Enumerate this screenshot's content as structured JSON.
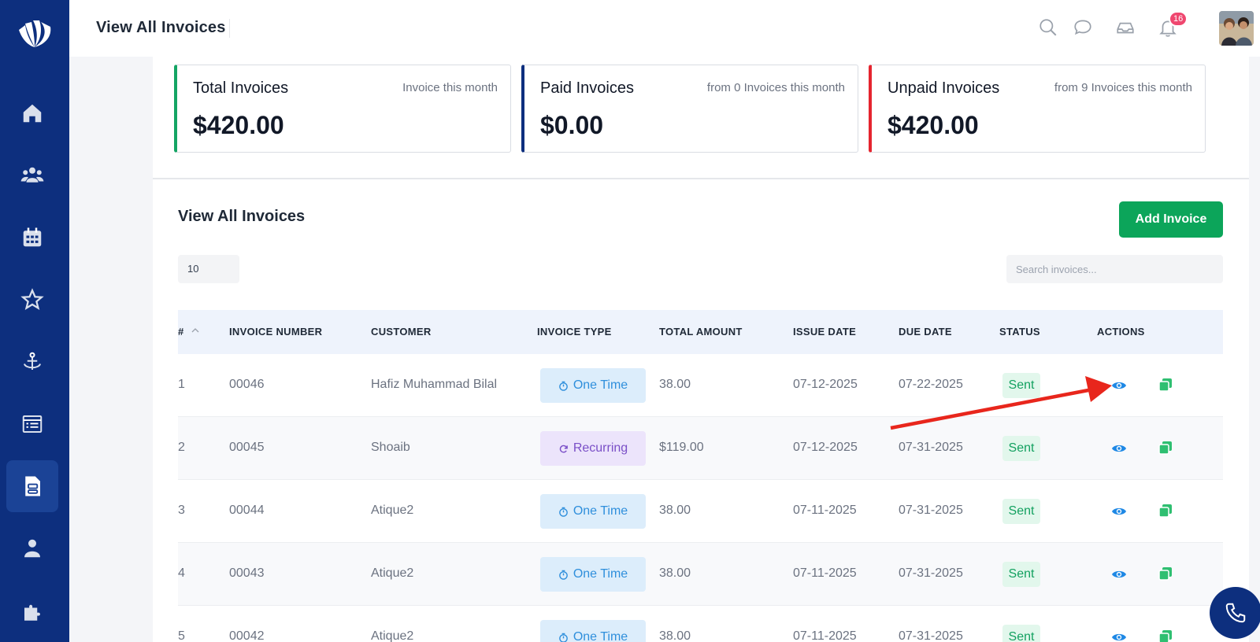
{
  "header": {
    "title": "View All Invoices",
    "notification_count": "16",
    "icons": [
      "search-icon",
      "chat-icon",
      "inbox-icon",
      "bell-icon"
    ]
  },
  "sidebar": {
    "icons": [
      "logo",
      "home-icon",
      "users-icon",
      "calendar-icon",
      "star-icon",
      "anchor-icon",
      "list-icon",
      "invoice-icon",
      "user-icon",
      "puzzle-icon"
    ],
    "active": "invoice-icon"
  },
  "cards": [
    {
      "title": "Total Invoices",
      "note": "Invoice this month",
      "amount": "$420.00",
      "accent": "#14a564"
    },
    {
      "title": "Paid Invoices",
      "note": "from 0 Invoices this month",
      "amount": "$0.00",
      "accent": "#0d2f7e"
    },
    {
      "title": "Unpaid Invoices",
      "note": "from 9 Invoices this month",
      "amount": "$420.00",
      "accent": "#e5252f"
    }
  ],
  "section": {
    "title": "View All Invoices",
    "add_button": "Add Invoice",
    "page_size": "10",
    "search_placeholder": "Search invoices..."
  },
  "table": {
    "columns": [
      "#",
      "INVOICE NUMBER",
      "CUSTOMER",
      "INVOICE TYPE",
      "TOTAL AMOUNT",
      "ISSUE DATE",
      "DUE DATE",
      "STATUS",
      "ACTIONS"
    ],
    "rows": [
      {
        "num": "1",
        "invoice": "00046",
        "customer": "Hafiz Muhammad Bilal",
        "type": "One Time",
        "amount": "38.00",
        "issue": "07-12-2025",
        "due": "07-22-2025",
        "status": "Sent"
      },
      {
        "num": "2",
        "invoice": "00045",
        "customer": "Shoaib",
        "type": "Recurring",
        "amount": "$119.00",
        "issue": "07-12-2025",
        "due": "07-31-2025",
        "status": "Sent"
      },
      {
        "num": "3",
        "invoice": "00044",
        "customer": "Atique2",
        "type": "One Time",
        "amount": "38.00",
        "issue": "07-11-2025",
        "due": "07-31-2025",
        "status": "Sent"
      },
      {
        "num": "4",
        "invoice": "00043",
        "customer": "Atique2",
        "type": "One Time",
        "amount": "38.00",
        "issue": "07-11-2025",
        "due": "07-31-2025",
        "status": "Sent"
      },
      {
        "num": "5",
        "invoice": "00042",
        "customer": "Atique2",
        "type": "One Time",
        "amount": "38.00",
        "issue": "07-11-2025",
        "due": "07-31-2025",
        "status": "Sent"
      }
    ]
  },
  "colors": {
    "sidebar": "#0d2f7e",
    "primary_button": "#0ca55a",
    "annotation_arrow": "#e8261c"
  }
}
